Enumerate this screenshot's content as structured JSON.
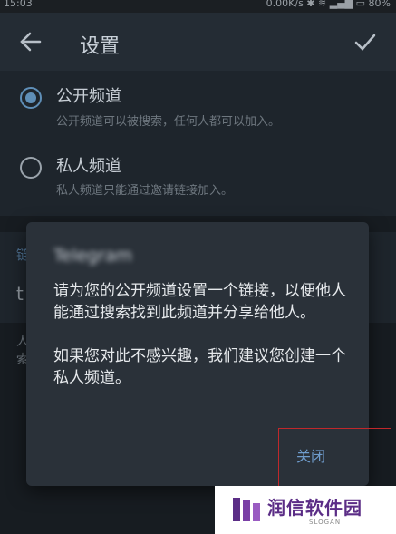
{
  "status_bar": {
    "time": "15:03",
    "right_text": "0.00K/s",
    "battery": "80%"
  },
  "appbar": {
    "title": "设置",
    "back_icon": "arrow-left-icon",
    "confirm_icon": "check-icon"
  },
  "options": [
    {
      "title": "公开频道",
      "desc": "公开频道可以被搜索，任何人都可以加入。",
      "selected": true
    },
    {
      "title": "私人频道",
      "desc": "私人频道只能通过邀请链接加入。",
      "selected": false
    }
  ],
  "background_fragments": {
    "link_label": "链",
    "link_value": "t",
    "hint_a": "人",
    "hint_b": "索"
  },
  "dialog": {
    "title": "Telegram",
    "message": "请为您的公开频道设置一个链接，以便他人能通过搜索找到此频道并分享给他人。\n\n如果您对此不感兴趣，我们建议您创建一个私人频道。",
    "close_label": "关闭"
  },
  "watermark": {
    "text": "润信软件园",
    "sub": "SLOGAN"
  },
  "colors": {
    "accent": "#5f8fb8",
    "dialog_bg": "#2a3139",
    "highlight": "#c0282b",
    "watermark_purple": "#5b2d86"
  }
}
